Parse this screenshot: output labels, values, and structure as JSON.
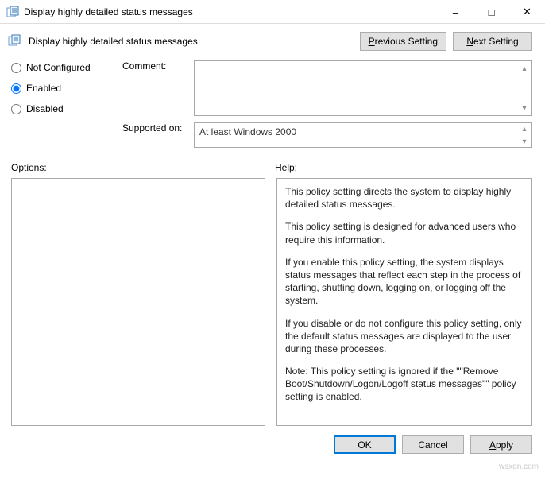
{
  "window": {
    "title": "Display highly detailed status messages"
  },
  "header": {
    "title": "Display highly detailed status messages",
    "prev_label_html": "<span class=\"u\">P</span>revious Setting",
    "next_label_html": "<span class=\"u\">N</span>ext Setting"
  },
  "state": {
    "options": [
      {
        "id": "not-configured",
        "label": "Not Configured",
        "checked": false
      },
      {
        "id": "enabled",
        "label": "Enabled",
        "checked": true
      },
      {
        "id": "disabled",
        "label": "Disabled",
        "checked": false
      }
    ]
  },
  "field_labels": {
    "comment": "Comment:",
    "supported": "Supported on:"
  },
  "supported_on": "At least Windows 2000",
  "sections": {
    "options": "Options:",
    "help": "Help:"
  },
  "help_paragraphs": [
    "This policy setting directs the system to display highly detailed status messages.",
    "This policy setting is designed for advanced users who require this information.",
    "If you enable this policy setting, the system displays status messages that reflect each step in the process of starting, shutting down, logging on, or logging off the system.",
    "If you disable or do not configure this policy setting, only the default status messages are displayed to the user during these processes.",
    "Note: This policy setting is ignored if the \"\"Remove Boot/Shutdown/Logon/Logoff status messages\"\" policy setting is enabled."
  ],
  "footer": {
    "ok": "OK",
    "cancel": "Cancel",
    "apply_html": "<span class=\"u\">A</span>pply"
  },
  "watermark": "wsxdn.com"
}
